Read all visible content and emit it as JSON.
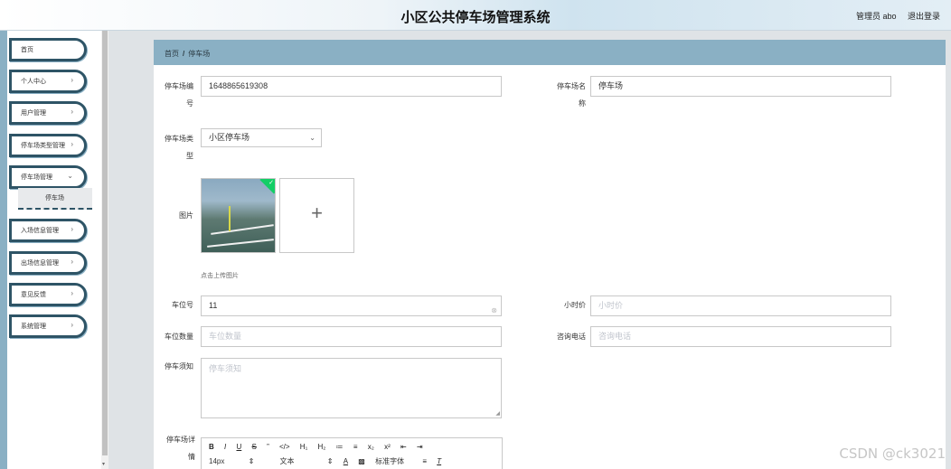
{
  "header": {
    "title": "小区公共停车场管理系统",
    "user_label": "管理员 abo",
    "logout": "退出登录"
  },
  "sidebar": {
    "items": [
      {
        "label": "首页"
      },
      {
        "label": "个人中心"
      },
      {
        "label": "用户管理"
      },
      {
        "label": "停车场类型管理"
      },
      {
        "label": "停车场管理"
      },
      {
        "label": "入场信息管理"
      },
      {
        "label": "出场信息管理"
      },
      {
        "label": "意见反馈"
      },
      {
        "label": "系统管理"
      }
    ],
    "submenu_label": "停车场"
  },
  "breadcrumb": {
    "home": "首页",
    "separator": "/",
    "current": "停车场"
  },
  "form": {
    "lot_no_label": "停车场编号",
    "lot_no_value": "1648865619308",
    "lot_name_label": "停车场名称",
    "lot_name_value": "停车场",
    "lot_type_label": "停车场类型",
    "lot_type_value": "小区停车场",
    "image_label": "图片",
    "upload_hint": "点击上传图片",
    "space_no_label": "车位号",
    "space_no_value": "11",
    "hourly_price_label": "小时价",
    "hourly_price_placeholder": "小时价",
    "space_count_label": "车位数量",
    "space_count_placeholder": "车位数量",
    "phone_label": "咨询电话",
    "phone_placeholder": "咨询电话",
    "notice_label": "停车须知",
    "notice_placeholder": "停车须知",
    "detail_label": "停车场详情"
  },
  "editor": {
    "toolbar_row1": [
      "B",
      "I",
      "U",
      "S",
      "”",
      "</>",
      "H₁",
      "H₂",
      "≔",
      "≡",
      "x₂",
      "x²",
      "⇤",
      "⇥"
    ],
    "font_size": "14px",
    "text_style": "文本",
    "font_family": "标准字体"
  },
  "watermark": "CSDN @ck3021"
}
